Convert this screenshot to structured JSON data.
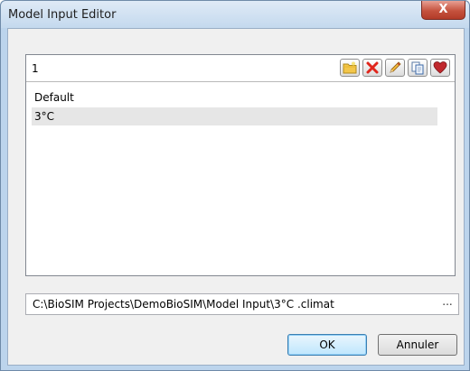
{
  "window": {
    "title": "Model Input Editor",
    "close_label": "X"
  },
  "list": {
    "header_text": "1",
    "toolbar": [
      {
        "name": "new-folder-button",
        "icon": "folder-icon"
      },
      {
        "name": "delete-button",
        "icon": "red-x-icon"
      },
      {
        "name": "edit-button",
        "icon": "pencil-icon"
      },
      {
        "name": "copy-button",
        "icon": "copy-icon"
      },
      {
        "name": "favorite-button",
        "icon": "heart-icon"
      }
    ],
    "items": [
      {
        "label": "Default"
      },
      {
        "label": "3°C"
      }
    ],
    "selected_index": 1
  },
  "path_field": {
    "value": "C:\\BioSIM Projects\\DemoBioSIM\\Model Input\\3°C .climat",
    "browse_label": "..."
  },
  "buttons": {
    "ok_label": "OK",
    "cancel_label": "Annuler"
  },
  "colors": {
    "accent_close": "#c5523e",
    "default_button": "#bee6fd",
    "selection": "#e6e6e6"
  }
}
